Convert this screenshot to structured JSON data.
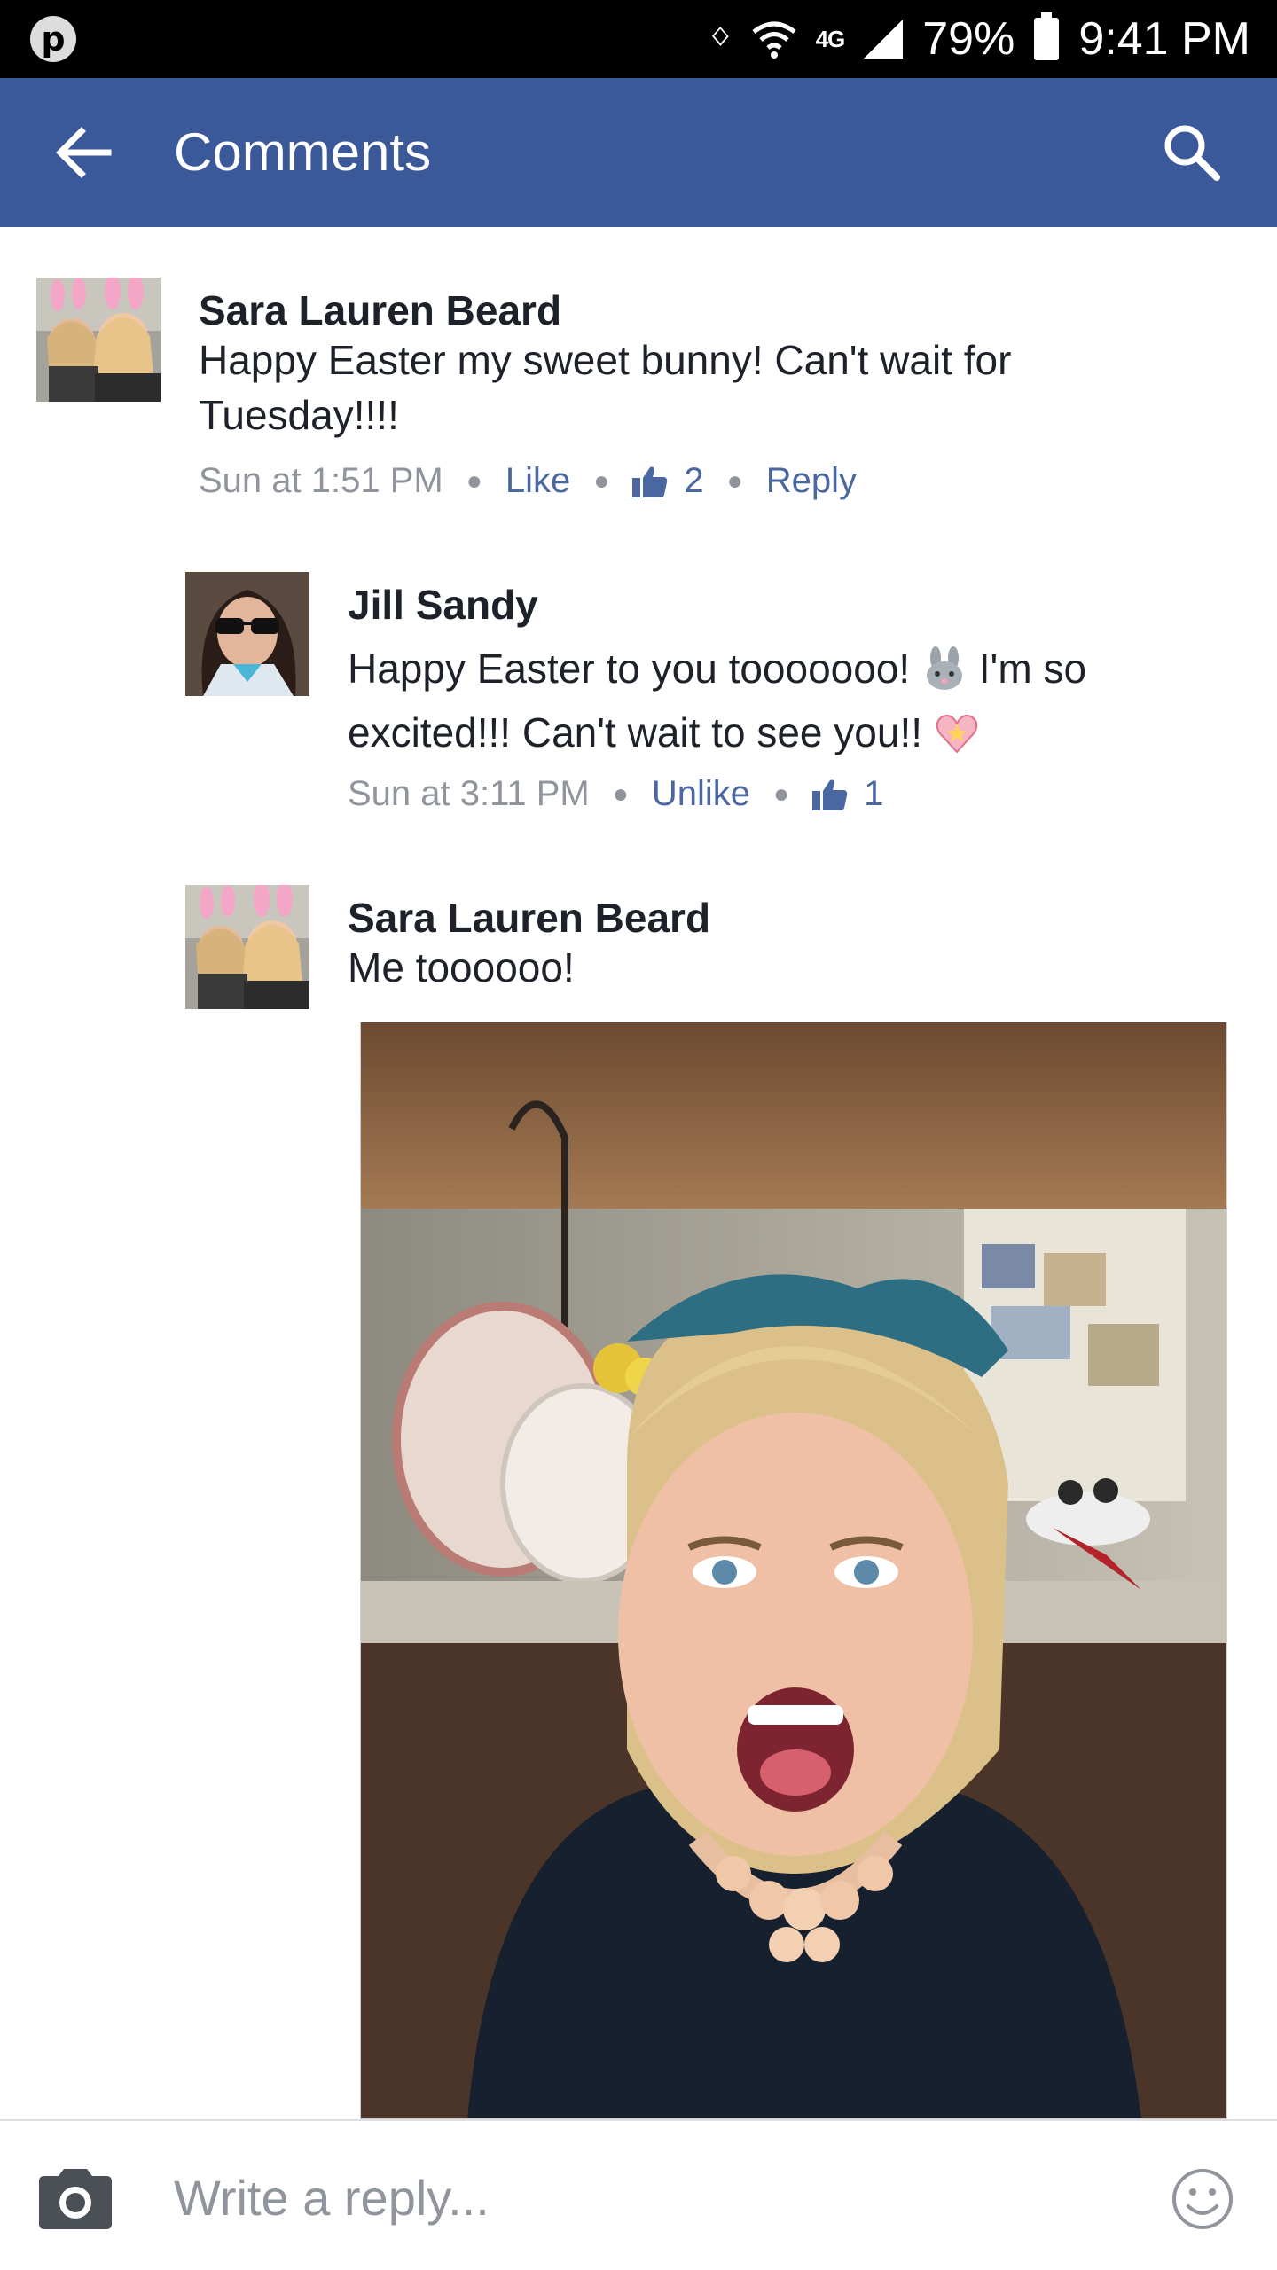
{
  "status_bar": {
    "network": "4G",
    "battery": "79%",
    "time": "9:41 PM"
  },
  "header": {
    "title": "Comments"
  },
  "comments": [
    {
      "author": "Sara Lauren Beard",
      "text": "Happy Easter my sweet bunny! Can't wait for Tuesday!!!!",
      "time": "Sun at 1:51 PM",
      "like_label": "Like",
      "like_count": "2",
      "reply_label": "Reply"
    },
    {
      "author": "Jill Sandy",
      "text_part1": "Happy Easter to you tooooooo!",
      "text_part2": "I'm so excited!!! Can't wait to see you!!",
      "time": "Sun at 3:11 PM",
      "like_label": "Unlike",
      "like_count": "1"
    },
    {
      "author": "Sara Lauren Beard",
      "text": "Me toooooo!"
    }
  ],
  "reply_bar": {
    "placeholder": "Write a reply..."
  },
  "colors": {
    "brand": "#3b5998",
    "link": "#4b67a1",
    "meta": "#90949c"
  }
}
